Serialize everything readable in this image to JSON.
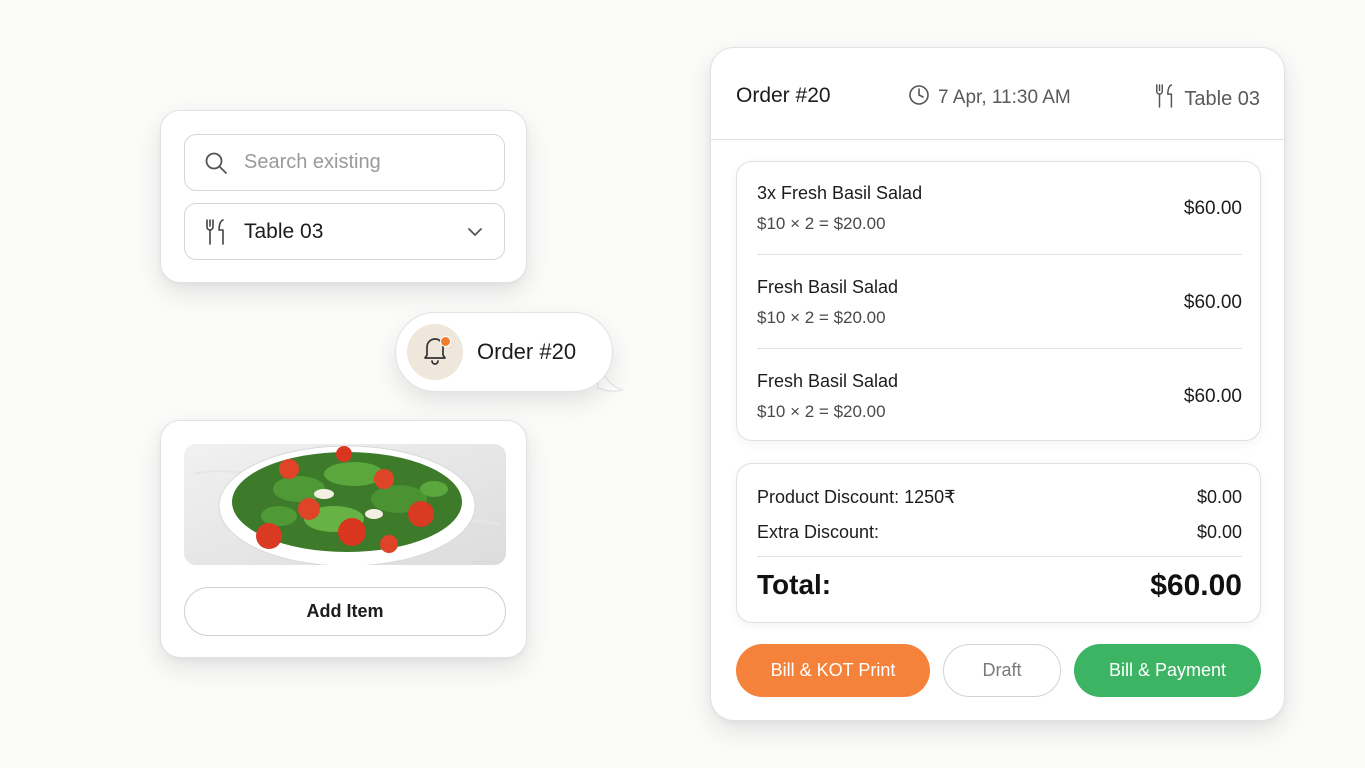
{
  "search_card": {
    "search_placeholder": "Search existing",
    "table_select_value": "Table 03",
    "icons": {
      "search": "search-icon",
      "table": "fork-knife-icon",
      "dropdown": "chevron-down-icon"
    }
  },
  "notification": {
    "label": "Order #20",
    "icon": "bell-icon",
    "dot_color": "#f07d2d"
  },
  "product_card": {
    "image": "salad-bowl-image",
    "add_button_label": "Add Item"
  },
  "order": {
    "title": "Order #20",
    "time": "7 Apr, 11:30 AM",
    "table": "Table 03",
    "items": [
      {
        "name": "3x Fresh Basil Salad",
        "calc": "$10 × 2 = $20.00",
        "price": "$60.00"
      },
      {
        "name": "Fresh Basil Salad",
        "calc": "$10 × 2 = $20.00",
        "price": "$60.00"
      },
      {
        "name": "Fresh Basil Salad",
        "calc": "$10 × 2 = $20.00",
        "price": "$60.00"
      }
    ],
    "summary": {
      "product_discount_label": "Product Discount: 1250₹",
      "product_discount_value": "$0.00",
      "extra_discount_label": "Extra Discount:",
      "extra_discount_value": "$0.00",
      "total_label": "Total:",
      "total_value": "$60.00"
    },
    "actions": {
      "bill_kot_label": "Bill & KOT Print",
      "draft_label": "Draft",
      "bill_payment_label": "Bill & Payment"
    }
  },
  "colors": {
    "accent_orange": "#f5823a",
    "accent_green": "#3cb464",
    "background": "#fbfbfa"
  }
}
